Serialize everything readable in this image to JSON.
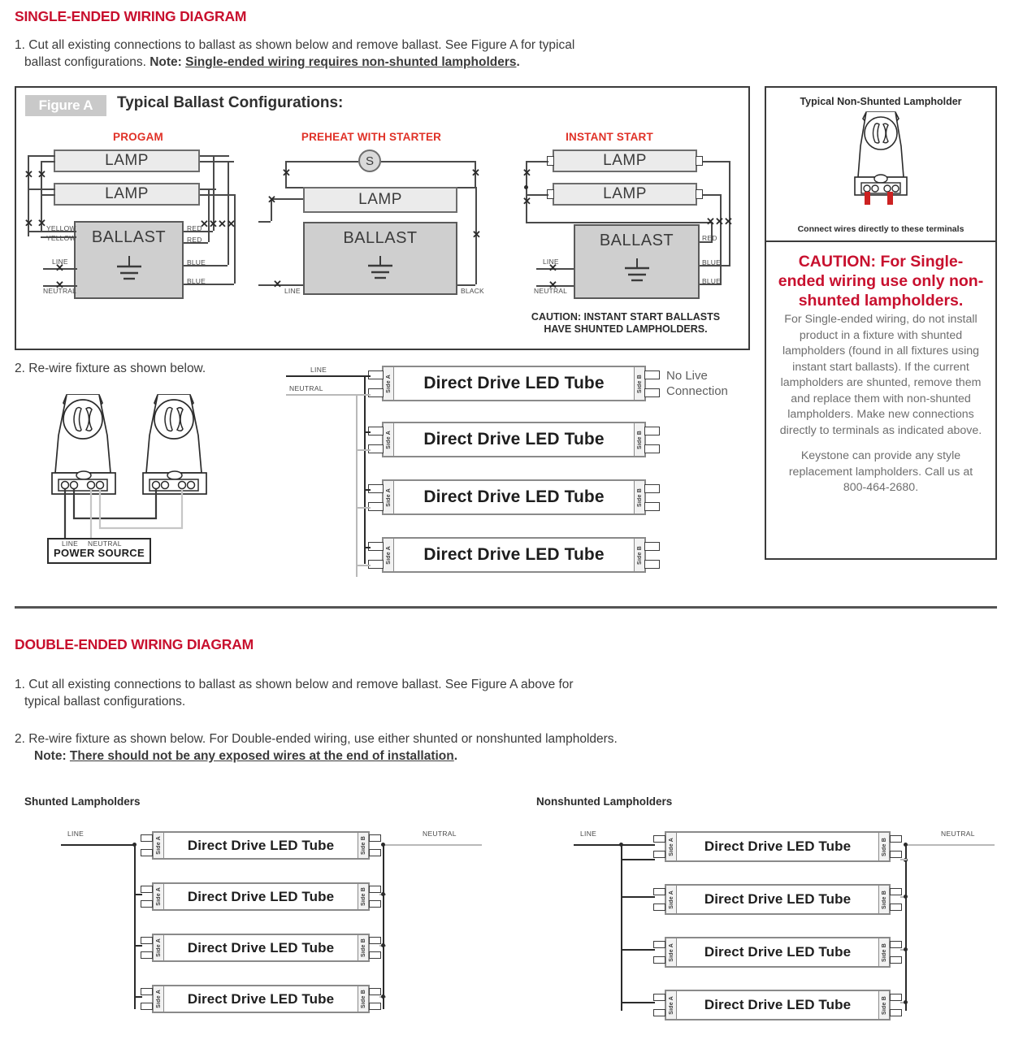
{
  "colors": {
    "heading_red": "#c8102e",
    "config_red": "#e03127",
    "body_gray": "#3b3b3b",
    "panel_body_gray": "#6e6e6e",
    "badge_gray": "#c9c9c9",
    "lamp_fill": "#ebebeb",
    "ballast_fill": "#cfcfcf",
    "terminal_red": "#cc2222"
  },
  "single_ended": {
    "title": "SINGLE-ENDED WIRING DIAGRAM",
    "step1_num": "1.",
    "step1_line1": "Cut all existing connections to ballast as shown below and remove ballast. See Figure A for typical",
    "step1_line2_a": "ballast configurations. ",
    "step1_note_label": "Note: ",
    "step1_note_text": "Single-ended wiring requires non-shunted lampholders",
    "step1_note_end": ".",
    "step2_num": "2.",
    "step2_text": "Re-wire fixture as shown below.",
    "power_source_label": "POWER SOURCE",
    "power_line": "LINE",
    "power_neutral": "NEUTRAL",
    "feed_line": "LINE",
    "feed_neutral": "NEUTRAL",
    "no_live_line1": "No Live",
    "no_live_line2": "Connection",
    "tube_label": "Direct Drive LED Tube",
    "side_a": "Side A",
    "side_b": "Side B",
    "tube_count": 4
  },
  "figure_a": {
    "badge": "Figure A",
    "title": "Typical Ballast Configurations:",
    "configs": [
      {
        "name": "PROGAM",
        "lamps": [
          "LAMP",
          "LAMP"
        ],
        "ballast": "BALLAST",
        "left_wires": [
          "YELLOW",
          "YELLOW"
        ],
        "right_wires": [
          "RED",
          "RED",
          "BLUE",
          "BLUE"
        ],
        "supply": [
          "LINE",
          "NEUTRAL"
        ]
      },
      {
        "name": "PREHEAT WITH STARTER",
        "starter": "S",
        "lamps": [
          "LAMP"
        ],
        "ballast": "BALLAST",
        "left_wires": [],
        "right_wires": [
          "BLACK"
        ],
        "supply": [
          "LINE"
        ]
      },
      {
        "name": "INSTANT START",
        "lamps": [
          "LAMP",
          "LAMP"
        ],
        "ballast": "BALLAST",
        "right_wires": [
          "RED",
          "BLUE",
          "BLUE"
        ],
        "supply": [
          "LINE",
          "NEUTRAL"
        ],
        "caution_line1": "CAUTION: INSTANT START BALLASTS",
        "caution_line2": "HAVE SHUNTED LAMPHOLDERS."
      }
    ]
  },
  "right_panel": {
    "lampholder_title": "Typical Non-Shunted Lampholder",
    "lampholder_caption": "Connect wires directly to these terminals",
    "caution_heading_l1": "CAUTION: For Single-",
    "caution_heading_l2": "ended wiring use only",
    "caution_heading_l3": "non-shunted lampholders.",
    "caution_body": "For Single-ended wiring, do not install product in a fixture with shunted lampholders (found in all fixtures using instant start ballasts). If the current lampholders are shunted, remove them and replace them with non-shunted lampholders. Make new connections directly to terminals as indicated above.",
    "contact_body": "Keystone can provide any style replacement lampholders. Call us at 800-464-2680.",
    "phone": "800-464-2680"
  },
  "double_ended": {
    "title": "DOUBLE-ENDED WIRING DIAGRAM",
    "step1_num": "1.",
    "step1_line1": "Cut all existing connections to ballast as shown below and remove ballast. See Figure A above for",
    "step1_line2": "typical ballast configurations.",
    "step2_num": "2.",
    "step2_text": "Re-wire fixture as shown below. For Double-ended wiring, use either shunted or nonshunted lampholders.",
    "note_label": "Note: ",
    "note_text": "There should not be any exposed wires at the end of installation",
    "note_end": ".",
    "left_heading": "Shunted Lampholders",
    "right_heading": "Nonshunted Lampholders",
    "line_label": "LINE",
    "neutral_label": "NEUTRAL",
    "tube_label": "Direct Drive LED Tube",
    "side_a": "Side A",
    "side_b": "Side B",
    "tube_count": 4
  }
}
